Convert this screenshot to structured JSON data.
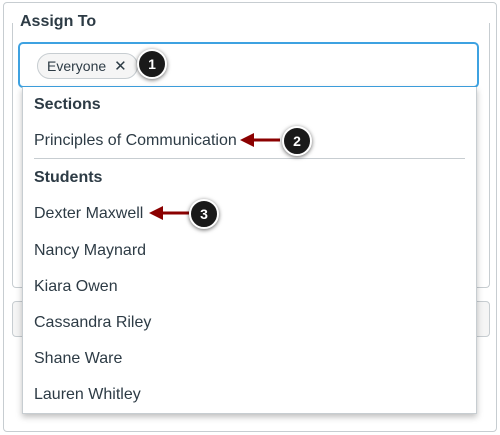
{
  "assign_to": {
    "label": "Assign To",
    "tokens": [
      {
        "label": "Everyone",
        "remove_icon": "close-icon",
        "remove_glyph": "✕"
      }
    ]
  },
  "dropdown": {
    "sections": {
      "header": "Sections",
      "items": [
        "Principles of Communication"
      ]
    },
    "students": {
      "header": "Students",
      "items": [
        "Dexter Maxwell",
        "Nancy Maynard",
        "Kiara Owen",
        "Cassandra Riley",
        "Shane Ware",
        "Lauren Whitley"
      ]
    }
  },
  "callouts": [
    "1",
    "2",
    "3"
  ],
  "colors": {
    "focus_border": "#3ea2e1",
    "callout_bg": "#1a1a1a",
    "arrow": "#8b0000",
    "text": "#2d3b45"
  }
}
